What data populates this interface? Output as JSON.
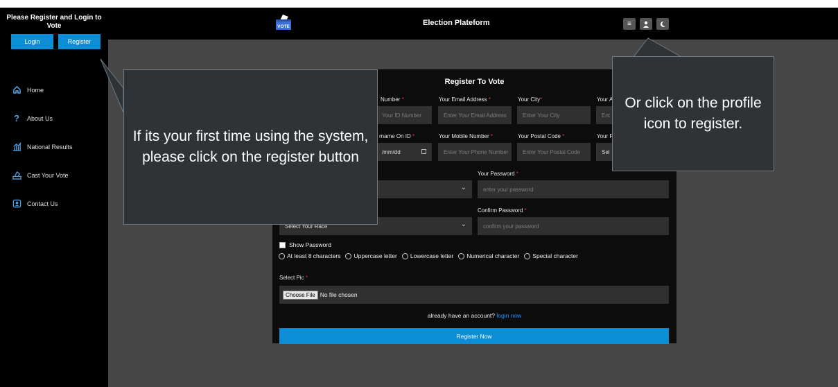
{
  "sidebar": {
    "title": "Please Register and Login to Vote",
    "login_label": "Login",
    "register_label": "Register",
    "nav": [
      {
        "label": "Home",
        "icon": "home-icon"
      },
      {
        "label": "About Us",
        "icon": "question-icon"
      },
      {
        "label": "National Results",
        "icon": "chart-icon"
      },
      {
        "label": "Cast Your Vote",
        "icon": "ballot-icon"
      },
      {
        "label": "Contact Us",
        "icon": "contact-icon"
      }
    ]
  },
  "header": {
    "logo_text": "VOTE",
    "title": "Election Plateform"
  },
  "form": {
    "title": "Register To Vote",
    "row1": {
      "id_label": "Number",
      "id_placeholder": "Your ID Number",
      "email_label": "Your Email Address",
      "email_placeholder": "Enter Your Email Address",
      "city_label": "Your City",
      "city_placeholder": "Enter Your City",
      "extra_label": "Your A",
      "extra_placeholder": "Ent"
    },
    "row2": {
      "surname_label": "rname On ID",
      "dob_placeholder": "/mm/dd",
      "mobile_label": "Your Mobile Number",
      "mobile_placeholder": "Enter Your Phone Number",
      "postal_label": "Your Postal Code",
      "postal_placeholder": "Enter Your Postal Code",
      "extra_label": "Your F",
      "extra_placeholder": "Sel"
    },
    "password_label": "Your Password",
    "password_placeholder": "enter your password",
    "confirm_label": "Confirm Password",
    "confirm_placeholder": "confirm your password",
    "race_placeholder": "Select Your Race",
    "show_password": "Show Password",
    "criteria": [
      "At least 8 characters",
      "Uppercase letter",
      "Lowercase letter",
      "Numerical character",
      "Special character"
    ],
    "select_pic_label": "Select Pic",
    "choose_file": "Choose File",
    "no_file": "No file chosen",
    "account_text": "already have an account?",
    "login_now": "login now",
    "submit_label": "Register Now"
  },
  "callouts": {
    "first": "If its your first time using the system, please click on the register button",
    "second": "Or click on the profile icon to register."
  },
  "colors": {
    "accent": "#0b8ed6",
    "required": "#e53935",
    "link": "#1e90ff"
  }
}
